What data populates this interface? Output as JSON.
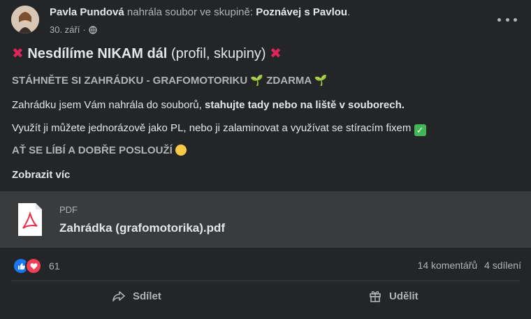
{
  "post": {
    "author": "Pavla Pundová",
    "action_text": "nahrála soubor ve skupině:",
    "group": "Poznávej s Pavlou",
    "period": ".",
    "date": "30. září",
    "date_sep": "·",
    "title_bold": "Nesdílíme NIKAM dál",
    "title_rest": "(profil, skupiny)",
    "line_download": "STÁHNĚTE SI ZAHRÁDKU - GRAFOMOTORIKU",
    "line_download_free": "ZDARMA",
    "line_upload_a": "Zahrádku jsem Vám nahrála do souborů,",
    "line_upload_b": "stahujte tady nebo na liště v souborech.",
    "line_use": "Využít ji můžete jednorázově jako PL, nebo ji zalaminovat a využívat se stíracím fixem",
    "line_enjoy": "AŤ SE LÍBÍ A DOBŘE POSLOUŽÍ",
    "show_more": "Zobrazit víc"
  },
  "attachment": {
    "type": "PDF",
    "name": "Zahrádka (grafomotorika).pdf"
  },
  "reactions": {
    "count": "61",
    "comments": "14 komentářů",
    "shares": "4 sdílení"
  },
  "actions": {
    "share": "Sdílet",
    "award": "Udělit"
  },
  "icons": [
    "avatar",
    "globe-icon",
    "more-icon",
    "cross-mark-icon",
    "seedling-icon",
    "check-icon",
    "smile-icon",
    "pdf-icon",
    "like-icon",
    "love-icon",
    "share-icon",
    "gift-icon"
  ]
}
